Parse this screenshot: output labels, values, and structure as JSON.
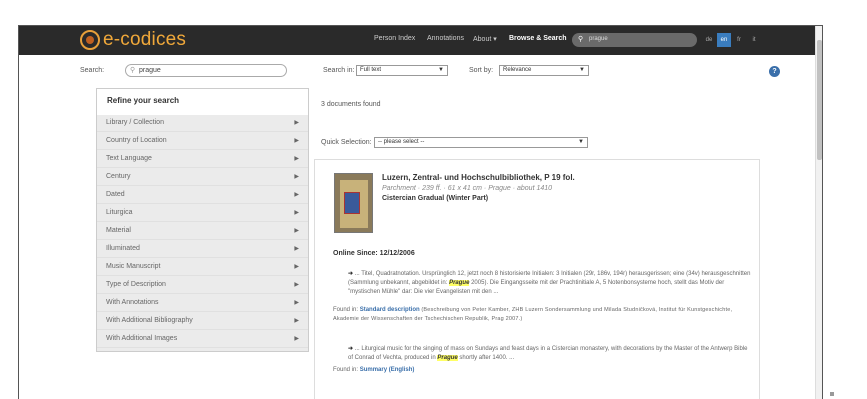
{
  "header": {
    "logo_text": "e-codices",
    "nav": [
      "Person Index",
      "Annotations",
      "About ▾",
      "Browse & Search"
    ],
    "search_value": "prague",
    "languages": [
      "de",
      "en",
      "fr",
      "it"
    ]
  },
  "search": {
    "label": "Search:",
    "value": "prague",
    "search_in_label": "Search in:",
    "search_in_value": "Full text",
    "sort_by_label": "Sort by:",
    "sort_by_value": "Relevance",
    "help_icon": "?"
  },
  "refine": {
    "title": "Refine your search",
    "facets": [
      "Library / Collection",
      "Country of Location",
      "Text Language",
      "Century",
      "Dated",
      "Liturgica",
      "Material",
      "Illuminated",
      "Music Manuscript",
      "Type of Description",
      "With Annotations",
      "With Additional Bibliography",
      "With Additional Images"
    ]
  },
  "results": {
    "count_text": "3 documents found",
    "quick_selection_label": "Quick Selection:",
    "quick_selection_value": "-- please select --",
    "item": {
      "title": "Luzern, Zentral- und Hochschulbibliothek, P 19 fol.",
      "meta": "Parchment · 239 ff. · 61 x 41 cm · Prague · about 1410",
      "subtitle": "Cistercian Gradual (Winter Part)",
      "online_since": "Online Since: 12/12/2006",
      "snippet1_a": "... Titel, Quadratnotation. Ursprünglich 12, jetzt noch 8 historisierte Initialen: 3 Initialen (29r, 186v, 194r) herausgerissen; eine (34v) herausgeschnitten (Sammlung unbekannt, abgebildet in:",
      "snippet1_hl": "Prague",
      "snippet1_b": "2005). Die Eingangsseite mit der Prachtinitiale A, 5 Notenbonsysteme hoch, stellt das Motiv der \"mystischen Mühle\" dar: Die vier Evangelisten mit den ...",
      "found_in_1_label": "Found in:",
      "found_in_1_link": "Standard description",
      "found_in_1_rest": "(Beschreibung von Peter Kamber, ZHB Luzern Sondersammlung und Milada Studničková, Institut für Kunstgeschichte, Akademie der Wissenschaften der Tschechischen Republik, Prag 2007.)",
      "snippet2_a": "... Liturgical music for the singing of mass on Sundays and feast days in a Cistercian monastery, with decorations by the Master of the Antwerp Bible of Conrad of Vechta, produced in",
      "snippet2_hl": "Prague",
      "snippet2_b": "shortly after 1400. ...",
      "found_in_2_label": "Found in:",
      "found_in_2_link": "Summary (English)"
    }
  }
}
